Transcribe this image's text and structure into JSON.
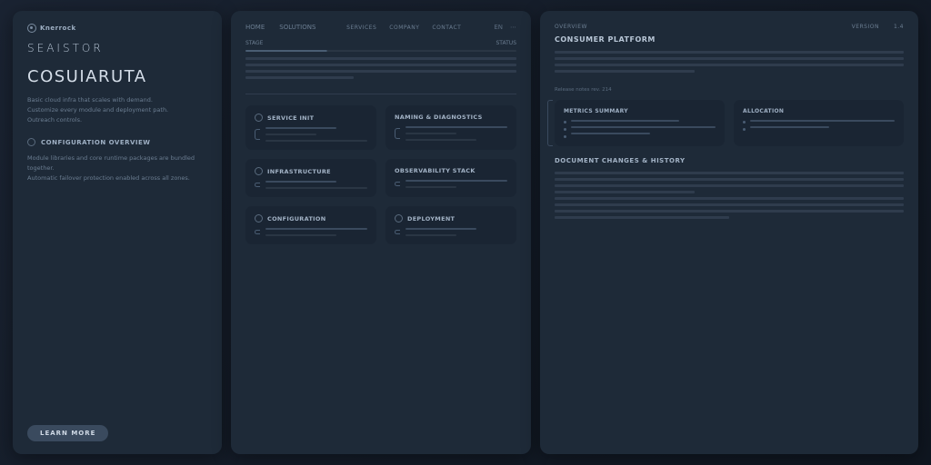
{
  "brand": "Knerrock",
  "nav": {
    "items": [
      "HOME",
      "SOLUTIONS",
      "SERVICES",
      "COMPANY",
      "CONTACT"
    ],
    "right": [
      "EN",
      "⋯"
    ]
  },
  "left": {
    "wordmark": "SEAISTOR",
    "title": "COSUIARUTA",
    "para1a": "Basic cloud infra that scales with demand.",
    "para1b": "Customize every module and deployment path.",
    "para1c": "Outreach controls.",
    "section_head": "CONFIGURATION OVERVIEW",
    "para2a": "Module libraries and core runtime packages are bundled together.",
    "para2b": "Automatic failover protection enabled across all zones.",
    "button": "LEARN MORE"
  },
  "mid": {
    "top_left": "STAGE",
    "top_right": "STATUS",
    "cards": [
      {
        "title": "SERVICE INIT"
      },
      {
        "title": "NAMING & DIAGNOSTICS"
      },
      {
        "title": "INFRASTRUCTURE"
      },
      {
        "title": "OBSERVABILITY STACK"
      },
      {
        "title": "CONFIGURATION"
      },
      {
        "title": "DEPLOYMENT"
      }
    ]
  },
  "right": {
    "top_left": "OVERVIEW",
    "top_right": "VERSION",
    "top_far": "1.4",
    "heading": "CONSUMER PLATFORM",
    "sub": "Release notes rev. 214",
    "cards": [
      {
        "title": "METRICS SUMMARY"
      },
      {
        "title": "ALLOCATION"
      }
    ],
    "subhead": "DOCUMENT CHANGES & HISTORY"
  }
}
